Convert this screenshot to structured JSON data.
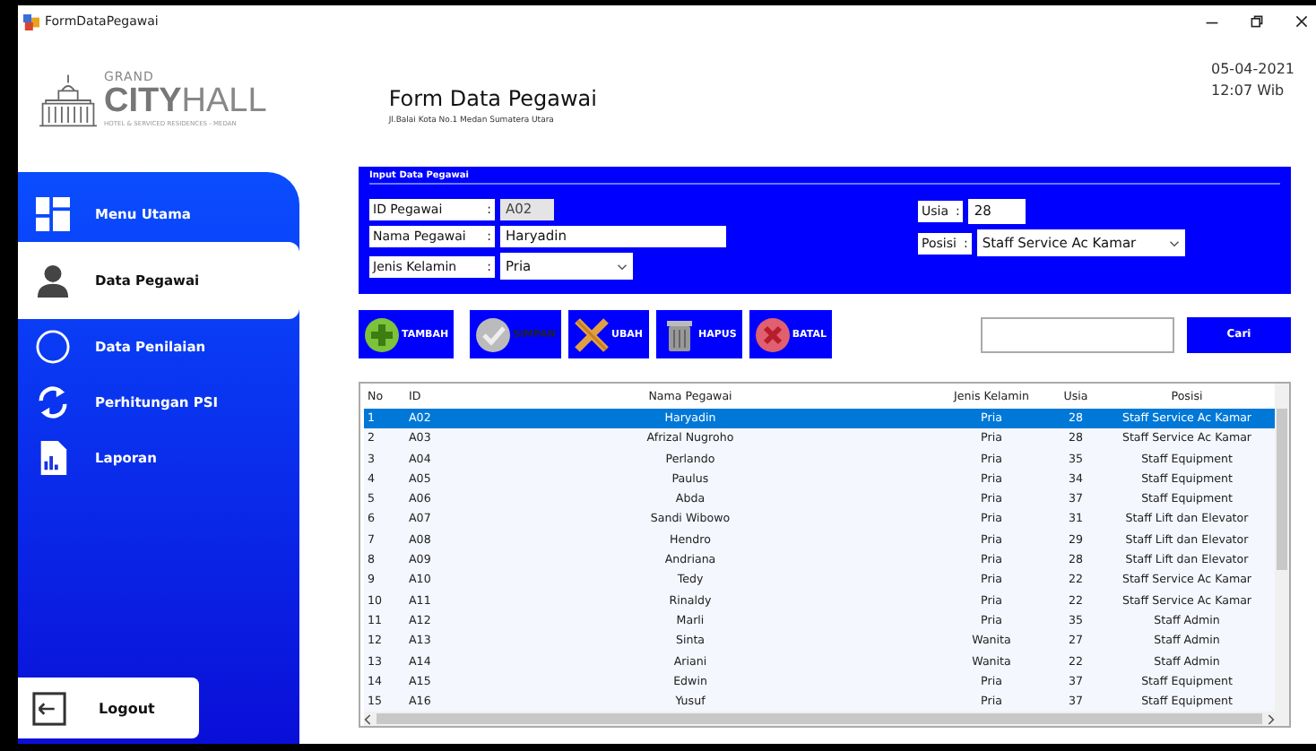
{
  "window": {
    "title": "FormDataPegawai"
  },
  "header": {
    "logo_small": "GRAND",
    "logo_main_bold": "CITY",
    "logo_main_light": "HALL",
    "logo_tagline": "HOTEL & SERVICED RESIDENCES - MEDAN",
    "title": "Form Data Pegawai",
    "address": "Jl.Balai Kota No.1 Medan Sumatera Utara",
    "date": "05-04-2021",
    "time": "12:07  Wib"
  },
  "sidebar": {
    "items": [
      {
        "label": "Menu Utama",
        "selected": false
      },
      {
        "label": "Data Pegawai",
        "selected": true
      },
      {
        "label": "Data Penilaian",
        "selected": false
      },
      {
        "label": "Perhitungan PSI",
        "selected": false
      },
      {
        "label": "Laporan",
        "selected": false
      }
    ],
    "logout": "Logout"
  },
  "input_panel": {
    "title": "Input Data Pegawai",
    "left_fields": [
      {
        "label": "ID Pegawai",
        "colon": ":",
        "kind": "text",
        "value": "A02",
        "disabled": true
      },
      {
        "label": "Nama Pegawai",
        "colon": ":",
        "kind": "text",
        "value": "Haryadin",
        "disabled": false
      },
      {
        "label": "Jenis Kelamin",
        "colon": ":",
        "kind": "select",
        "value": "Pria",
        "disabled": false
      }
    ],
    "right_fields": [
      {
        "label": "Usia",
        "colon": ":",
        "kind": "text",
        "value": "28",
        "disabled": false
      },
      {
        "label": "Posisi",
        "colon": ":",
        "kind": "select",
        "value": "Staff Service Ac Kamar",
        "disabled": false
      }
    ]
  },
  "actions": [
    {
      "label": "TAMBAH",
      "kind": "add",
      "disabled": false
    },
    {
      "label": "SIMPAN",
      "kind": "save",
      "disabled": true
    },
    {
      "label": "UBAH",
      "kind": "edit",
      "disabled": false
    },
    {
      "label": "HAPUS",
      "kind": "delete",
      "disabled": false
    },
    {
      "label": "BATAL",
      "kind": "cancel",
      "disabled": false
    }
  ],
  "search": {
    "button": "Cari"
  },
  "table": {
    "columns": [
      "No",
      "ID",
      "Nama Pegawai",
      "Jenis Kelamin",
      "Usia",
      "Posisi"
    ],
    "rows": [
      {
        "cells": [
          "1",
          "A02",
          "Haryadin",
          "Pria",
          "28",
          "Staff Service Ac Kamar"
        ],
        "selected": true
      },
      {
        "cells": [
          "2",
          "A03",
          "Afrizal Nugroho",
          "Pria",
          "28",
          "Staff Service Ac Kamar"
        ],
        "selected": false
      },
      {
        "cells": [
          "3",
          "A04",
          "Perlando",
          "Pria",
          "35",
          "Staff Equipment"
        ],
        "selected": false
      },
      {
        "cells": [
          "4",
          "A05",
          "Paulus",
          "Pria",
          "34",
          "Staff Equipment"
        ],
        "selected": false
      },
      {
        "cells": [
          "5",
          "A06",
          "Abda",
          "Pria",
          "37",
          "Staff Equipment"
        ],
        "selected": false
      },
      {
        "cells": [
          "6",
          "A07",
          "Sandi Wibowo",
          "Pria",
          "31",
          "Staff Lift dan Elevator"
        ],
        "selected": false
      },
      {
        "cells": [
          "7",
          "A08",
          "Hendro",
          "Pria",
          "29",
          "Staff Lift dan Elevator"
        ],
        "selected": false
      },
      {
        "cells": [
          "8",
          "A09",
          "Andriana",
          "Pria",
          "28",
          "Staff Lift dan Elevator"
        ],
        "selected": false
      },
      {
        "cells": [
          "9",
          "A10",
          "Tedy",
          "Pria",
          "22",
          "Staff Service Ac Kamar"
        ],
        "selected": false
      },
      {
        "cells": [
          "10",
          "A11",
          "Rinaldy",
          "Pria",
          "22",
          "Staff Service Ac Kamar"
        ],
        "selected": false
      },
      {
        "cells": [
          "11",
          "A12",
          "Marli",
          "Pria",
          "35",
          "Staff Admin"
        ],
        "selected": false
      },
      {
        "cells": [
          "12",
          "A13",
          "Sinta",
          "Wanita",
          "27",
          "Staff Admin"
        ],
        "selected": false
      },
      {
        "cells": [
          "13",
          "A14",
          "Ariani",
          "Wanita",
          "22",
          "Staff Admin"
        ],
        "selected": false
      },
      {
        "cells": [
          "14",
          "A15",
          "Edwin",
          "Pria",
          "37",
          "Staff Equipment"
        ],
        "selected": false
      },
      {
        "cells": [
          "15",
          "A16",
          "Yusuf",
          "Pria",
          "37",
          "Staff Equipment"
        ],
        "selected": false
      }
    ]
  }
}
